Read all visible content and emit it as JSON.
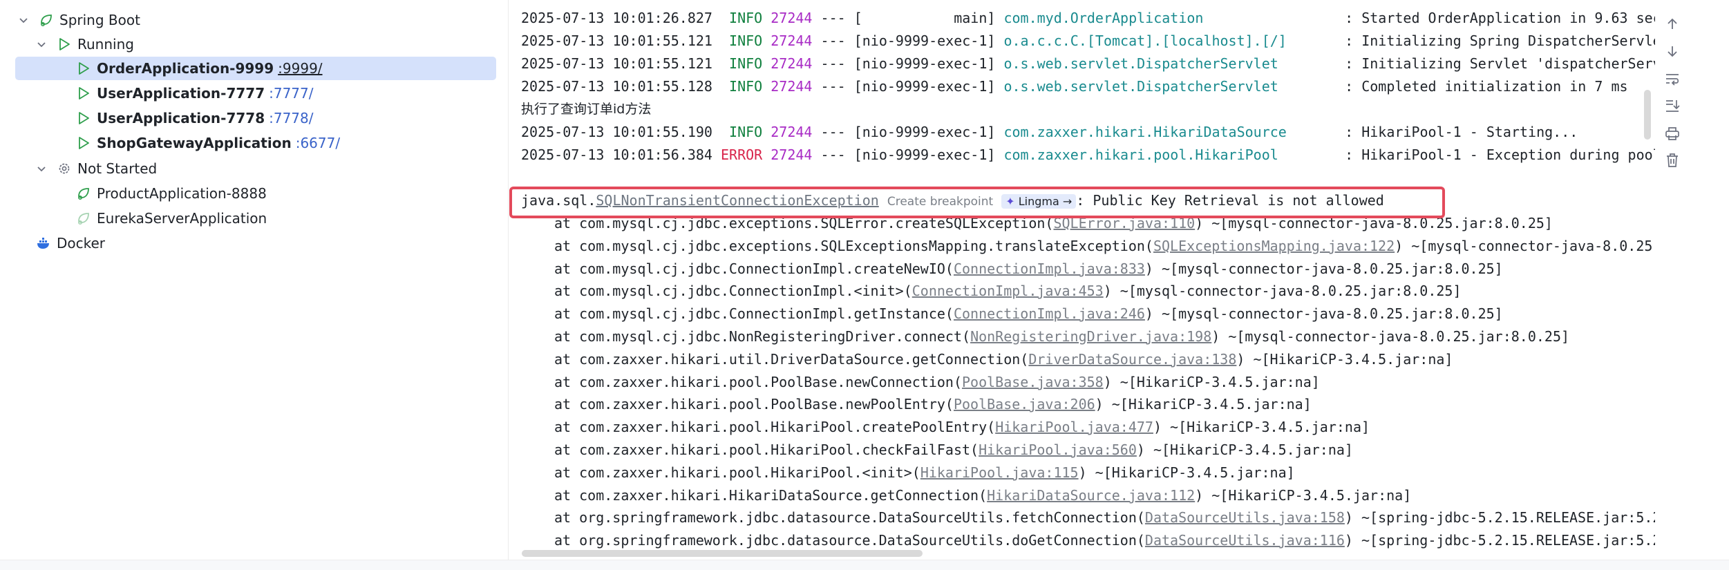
{
  "tree": {
    "root_label": "Spring Boot",
    "running_label": "Running",
    "running_apps": [
      {
        "name": "OrderApplication-9999",
        "port": ":9999/"
      },
      {
        "name": "UserApplication-7777",
        "port": ":7777/"
      },
      {
        "name": "UserApplication-7778",
        "port": ":7778/"
      },
      {
        "name": "ShopGatewayApplication",
        "port": ":6677/"
      }
    ],
    "not_started_label": "Not Started",
    "not_started_apps": [
      "ProductApplication-8888",
      "EurekaServerApplication"
    ],
    "docker_label": "Docker"
  },
  "console": {
    "log_lines": [
      {
        "date": "2025-07-13 10:01:26.827",
        "level": "INFO",
        "pid": "27244",
        "sep": "---",
        "thread": "[           main]",
        "logger": "com.myd.OrderApplication                ",
        "message": ": Started OrderApplication in 9.63 sec"
      },
      {
        "date": "2025-07-13 10:01:55.121",
        "level": "INFO",
        "pid": "27244",
        "sep": "---",
        "thread": "[nio-9999-exec-1]",
        "logger": "o.a.c.c.C.[Tomcat].[localhost].[/]      ",
        "message": ": Initializing Spring DispatcherServle"
      },
      {
        "date": "2025-07-13 10:01:55.121",
        "level": "INFO",
        "pid": "27244",
        "sep": "---",
        "thread": "[nio-9999-exec-1]",
        "logger": "o.s.web.servlet.DispatcherServlet       ",
        "message": ": Initializing Servlet 'dispatcherServ"
      },
      {
        "date": "2025-07-13 10:01:55.128",
        "level": "INFO",
        "pid": "27244",
        "sep": "---",
        "thread": "[nio-9999-exec-1]",
        "logger": "o.s.web.servlet.DispatcherServlet       ",
        "message": ": Completed initialization in 7 ms"
      }
    ],
    "chinese_line": "执行了查询订单id方法",
    "log_lines_2": [
      {
        "date": "2025-07-13 10:01:55.190",
        "level": "INFO",
        "pid": "27244",
        "sep": "---",
        "thread": "[nio-9999-exec-1]",
        "logger": "com.zaxxer.hikari.HikariDataSource      ",
        "message": ": HikariPool-1 - Starting..."
      },
      {
        "date": "2025-07-13 10:01:56.384",
        "level": "ERROR",
        "pid": "27244",
        "sep": "---",
        "thread": "[nio-9999-exec-1]",
        "logger": "com.zaxxer.hikari.pool.HikariPool       ",
        "message": ": HikariPool-1 - Exception during pool"
      }
    ],
    "exception": {
      "package": "java.sql.",
      "class_link": "SQLNonTransientConnectionException",
      "breakpoint_hint": "Create breakpoint",
      "lingma_label": "Lingma →",
      "message": ": Public Key Retrieval is not allowed"
    },
    "stack": [
      {
        "prefix": "at com.mysql.cj.jdbc.exceptions.SQLError.createSQLException(",
        "link": "SQLError.java:110",
        "suffix": ") ~[mysql-connector-java-8.0.25.jar:8.0.25]"
      },
      {
        "prefix": "at com.mysql.cj.jdbc.exceptions.SQLExceptionsMapping.translateException(",
        "link": "SQLExceptionsMapping.java:122",
        "suffix": ") ~[mysql-connector-java-8.0.25."
      },
      {
        "prefix": "at com.mysql.cj.jdbc.ConnectionImpl.createNewIO(",
        "link": "ConnectionImpl.java:833",
        "suffix": ") ~[mysql-connector-java-8.0.25.jar:8.0.25]"
      },
      {
        "prefix": "at com.mysql.cj.jdbc.ConnectionImpl.<init>(",
        "link": "ConnectionImpl.java:453",
        "suffix": ") ~[mysql-connector-java-8.0.25.jar:8.0.25]"
      },
      {
        "prefix": "at com.mysql.cj.jdbc.ConnectionImpl.getInstance(",
        "link": "ConnectionImpl.java:246",
        "suffix": ") ~[mysql-connector-java-8.0.25.jar:8.0.25]"
      },
      {
        "prefix": "at com.mysql.cj.jdbc.NonRegisteringDriver.connect(",
        "link": "NonRegisteringDriver.java:198",
        "suffix": ") ~[mysql-connector-java-8.0.25.jar:8.0.25]"
      },
      {
        "prefix": "at com.zaxxer.hikari.util.DriverDataSource.getConnection(",
        "link": "DriverDataSource.java:138",
        "suffix": ") ~[HikariCP-3.4.5.jar:na]"
      },
      {
        "prefix": "at com.zaxxer.hikari.pool.PoolBase.newConnection(",
        "link": "PoolBase.java:358",
        "suffix": ") ~[HikariCP-3.4.5.jar:na]"
      },
      {
        "prefix": "at com.zaxxer.hikari.pool.PoolBase.newPoolEntry(",
        "link": "PoolBase.java:206",
        "suffix": ") ~[HikariCP-3.4.5.jar:na]"
      },
      {
        "prefix": "at com.zaxxer.hikari.pool.HikariPool.createPoolEntry(",
        "link": "HikariPool.java:477",
        "suffix": ") ~[HikariCP-3.4.5.jar:na]"
      },
      {
        "prefix": "at com.zaxxer.hikari.pool.HikariPool.checkFailFast(",
        "link": "HikariPool.java:560",
        "suffix": ") ~[HikariCP-3.4.5.jar:na]"
      },
      {
        "prefix": "at com.zaxxer.hikari.pool.HikariPool.<init>(",
        "link": "HikariPool.java:115",
        "suffix": ") ~[HikariCP-3.4.5.jar:na]"
      },
      {
        "prefix": "at com.zaxxer.hikari.HikariDataSource.getConnection(",
        "link": "HikariDataSource.java:112",
        "suffix": ") ~[HikariCP-3.4.5.jar:na]"
      },
      {
        "prefix": "at org.springframework.jdbc.datasource.DataSourceUtils.fetchConnection(",
        "link": "DataSourceUtils.java:158",
        "suffix": ") ~[spring-jdbc-5.2.15.RELEASE.jar:5.2"
      },
      {
        "prefix": "at org.springframework.jdbc.datasource.DataSourceUtils.doGetConnection(",
        "link": "DataSourceUtils.java:116",
        "suffix": ") ~[spring-jdbc-5.2.15.RELEASE.jar:5.2"
      }
    ]
  },
  "tools": [
    "arrow-up-icon",
    "arrow-down-icon",
    "soft-wrap-icon",
    "scroll-to-end-icon",
    "print-icon",
    "trash-icon"
  ],
  "colors": {
    "selection": "#d5e1fb",
    "info": "#11803f",
    "error": "#d8254b",
    "pid": "#a82bc5",
    "logger": "#1a8b8f",
    "highlight": "#e34a5b",
    "run": "#2e9e4b"
  }
}
